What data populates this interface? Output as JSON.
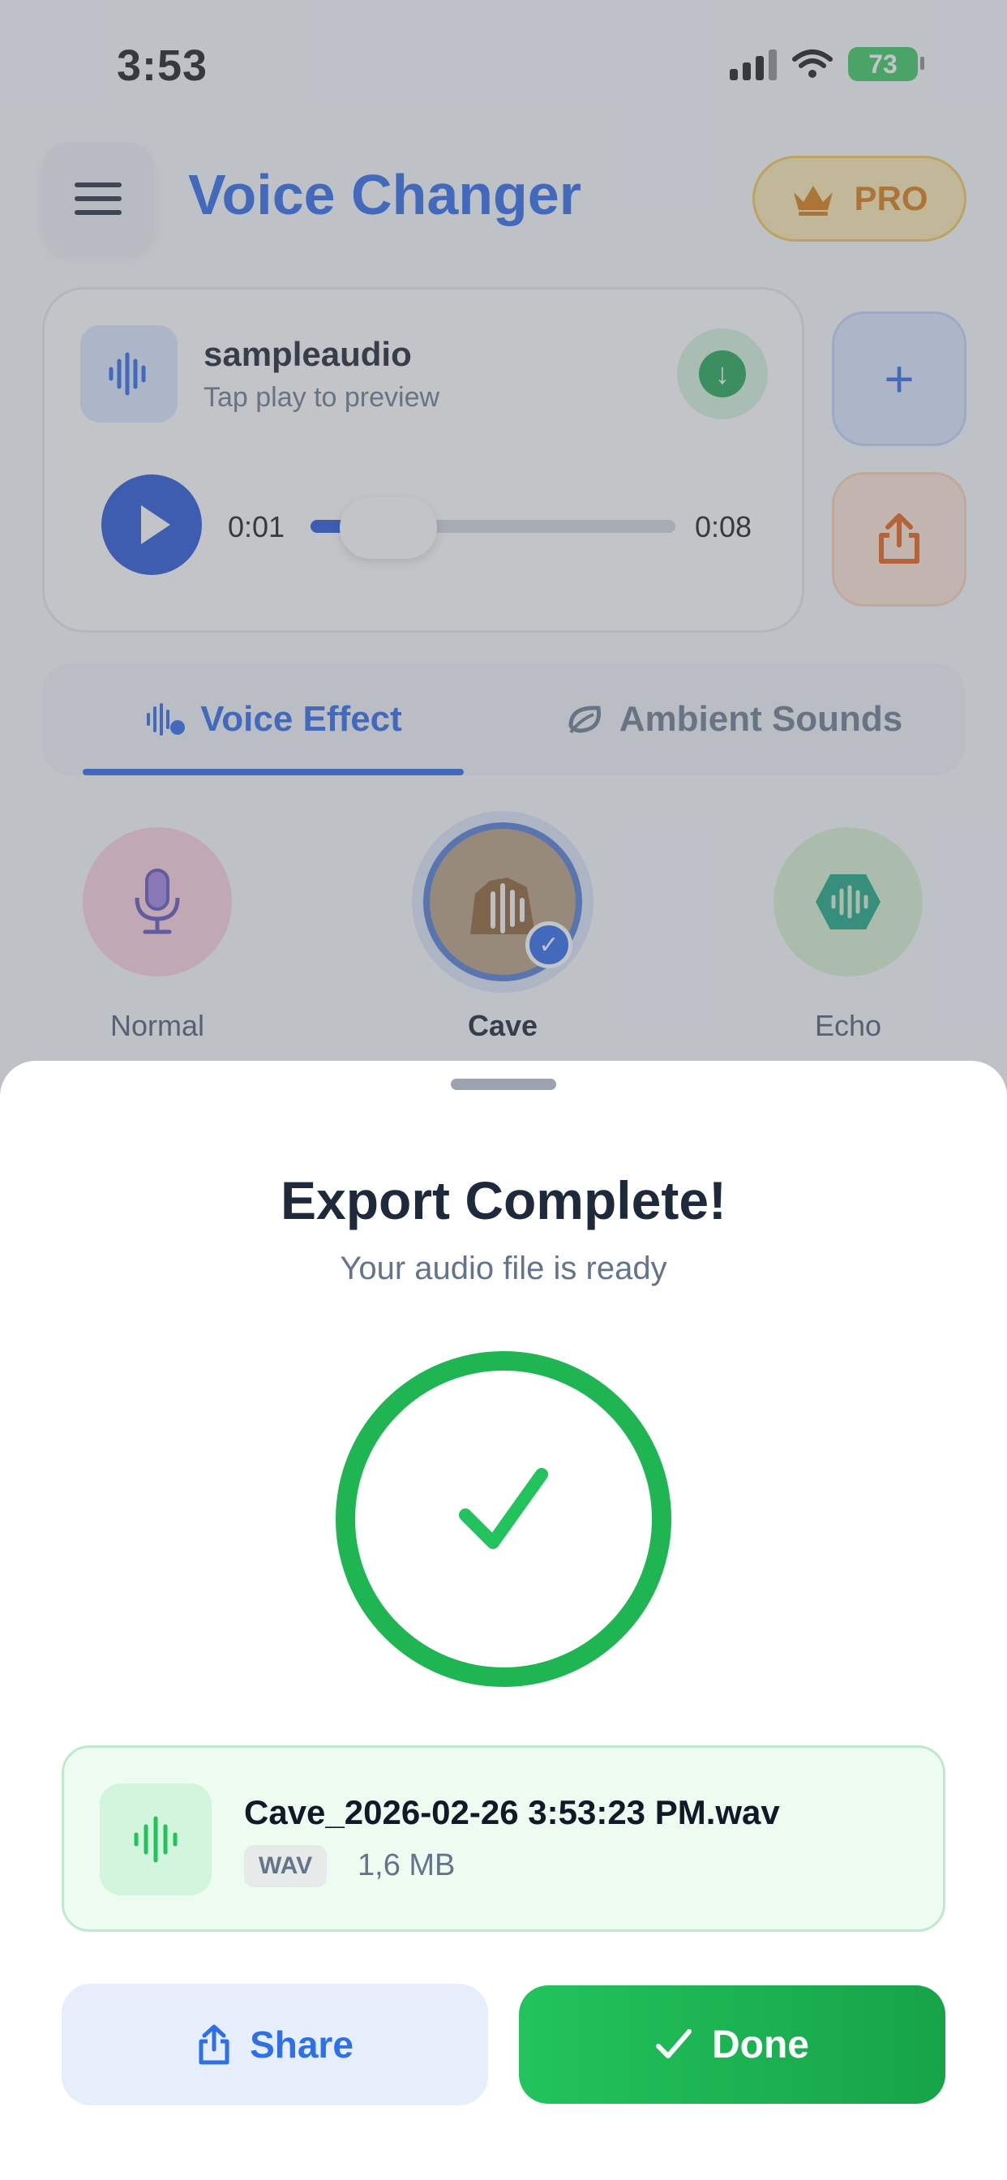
{
  "status_bar": {
    "time": "3:53",
    "battery": "73"
  },
  "header": {
    "title": "Voice Changer",
    "pro_label": "PRO"
  },
  "player": {
    "file_name": "sampleaudio",
    "subtitle": "Tap play to preview",
    "current_time": "0:01",
    "total_time": "0:08",
    "progress": 0.12
  },
  "tabs": [
    {
      "label": "Voice Effect",
      "active": true
    },
    {
      "label": "Ambient Sounds",
      "active": false
    }
  ],
  "effects": [
    {
      "label": "Normal",
      "icon": "microphone-icon"
    },
    {
      "label": "Cave",
      "icon": "cave-icon",
      "selected": true
    },
    {
      "label": "Echo",
      "icon": "echo-icon"
    }
  ],
  "sheet": {
    "title": "Export Complete!",
    "subtitle": "Your audio file is ready",
    "file": {
      "name": "Cave_2026-02-26 3:53:23 PM.wav",
      "format": "WAV",
      "size": "1,6 MB"
    },
    "share_label": "Share",
    "done_label": "Done"
  },
  "colors": {
    "accent": "#2563eb",
    "success": "#1fb552",
    "pro": "#d97706"
  }
}
